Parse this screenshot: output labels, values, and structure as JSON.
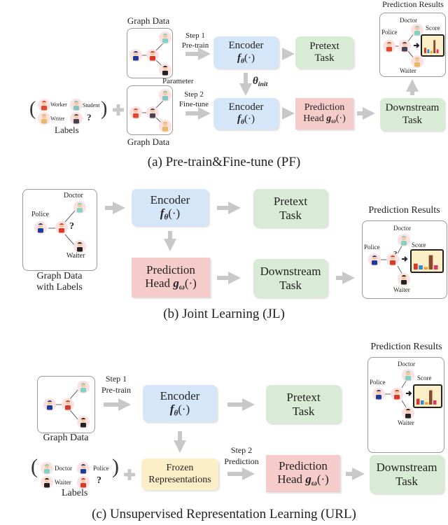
{
  "colors": {
    "encoder": "#d6e6f9",
    "task": "#d8ebd4",
    "head": "#f6cccb",
    "frozen": "#fcefc8",
    "arrow": "#c8c8c8"
  },
  "common": {
    "encoder": "Encoder",
    "f": "f",
    "theta": "θ",
    "args": "(·)",
    "g": "g",
    "omega": "ω",
    "pretext_1": "Pretext",
    "pretext_2": "Task",
    "pred_1": "Prediction",
    "pred_2": "Head",
    "down_1": "Downstream",
    "down_2": "Task",
    "results": "Prediction Results",
    "score": "Score",
    "doctor": "Doctor",
    "police": "Police",
    "waiter": "Waiter",
    "q": "?",
    "plus": "+",
    "lparen": "(",
    "rparen": ")",
    "labels": "Labels",
    "graph_data": "Graph Data"
  },
  "pf": {
    "step1": "Step 1",
    "pretrain": "Pre-train",
    "step2": "Step 2",
    "finetune": "Fine-tune",
    "parameter": "Parameter",
    "theta_init": "θ",
    "init": "init",
    "worker": "Worker",
    "student": "Student",
    "writer": "Writer",
    "caption": "(a)  Pre-train&Fine-tune (PF)"
  },
  "jl": {
    "graph_1": "Graph Data",
    "graph_2": "with Labels",
    "caption": "(b)  Joint Learning (JL)"
  },
  "url": {
    "step1": "Step 1",
    "pretrain": "Pre-train",
    "step2": "Step 2",
    "prediction": "Prediction",
    "frozen_1": "Frozen",
    "frozen_2": "Representations",
    "caption": "(c)  Unsupervised Representation Learning (URL)"
  }
}
